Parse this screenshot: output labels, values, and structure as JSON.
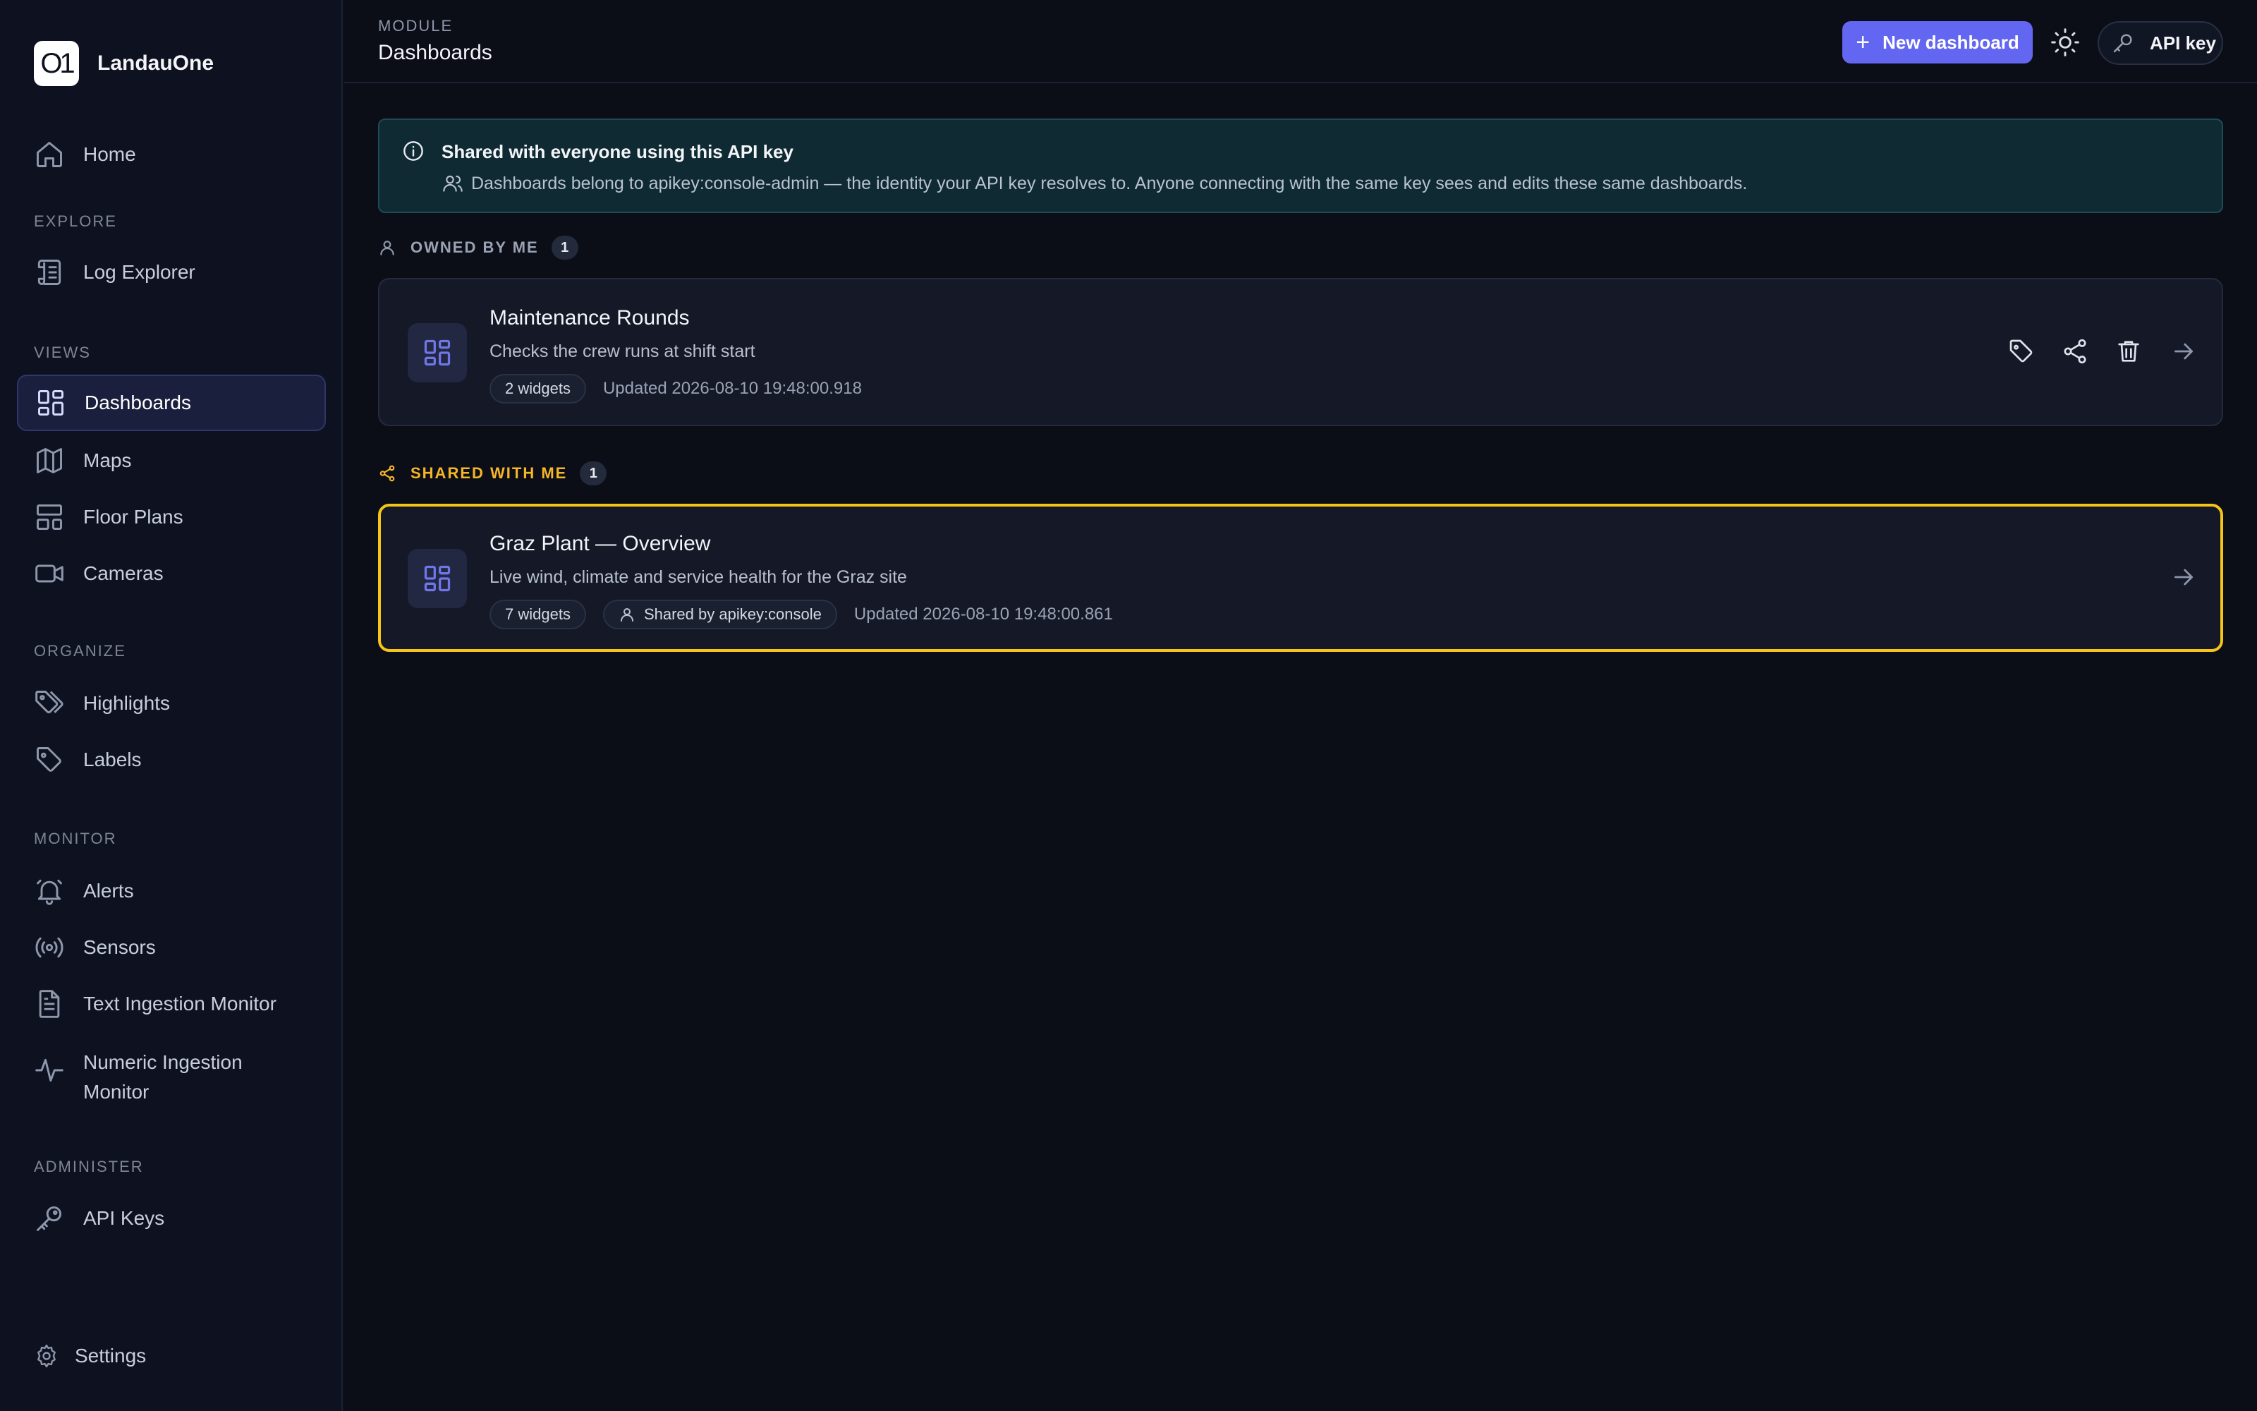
{
  "app": {
    "name": "LandauOne",
    "logo_text": "O1"
  },
  "sidebar": {
    "home": "Home",
    "sections": {
      "explore": "EXPLORE",
      "views": "VIEWS",
      "organize": "ORGANIZE",
      "monitor": "MONITOR",
      "administer": "ADMINISTER"
    },
    "items": {
      "log_explorer": "Log Explorer",
      "dashboards": "Dashboards",
      "maps": "Maps",
      "floor_plans": "Floor Plans",
      "cameras": "Cameras",
      "highlights": "Highlights",
      "labels": "Labels",
      "alerts": "Alerts",
      "sensors": "Sensors",
      "text_ingestion_monitor": "Text Ingestion Monitor",
      "numeric_ingestion_monitor": "Numeric Ingestion Monitor",
      "api_keys": "API Keys"
    },
    "settings": "Settings",
    "active_item": "dashboards"
  },
  "header": {
    "module_label": "MODULE",
    "title": "Dashboards",
    "new_dashboard": "New dashboard",
    "api_key": "API key"
  },
  "banner": {
    "title": "Shared with everyone using this API key",
    "text": "Dashboards belong to apikey:console-admin — the identity your API key resolves to. Anyone connecting with the same key sees and edits these same dashboards."
  },
  "owned": {
    "heading": "OWNED BY ME",
    "count": "1",
    "dashboards": [
      {
        "title": "Maintenance Rounds",
        "description": "Checks the crew runs at shift start",
        "widgets": "2 widgets",
        "updated": "Updated 2026-08-10 19:48:00.918"
      }
    ]
  },
  "shared": {
    "heading": "SHARED WITH ME",
    "count": "1",
    "dashboards": [
      {
        "title": "Graz Plant — Overview",
        "description": "Live wind, climate and service health for the Graz site",
        "widgets": "7 widgets",
        "shared_by": "Shared by apikey:console",
        "updated": "Updated 2026-08-10 19:48:00.861"
      }
    ]
  },
  "colors": {
    "accent": "#6366f1",
    "shared_highlight": "#f5c518",
    "background": "#0b0e17"
  }
}
